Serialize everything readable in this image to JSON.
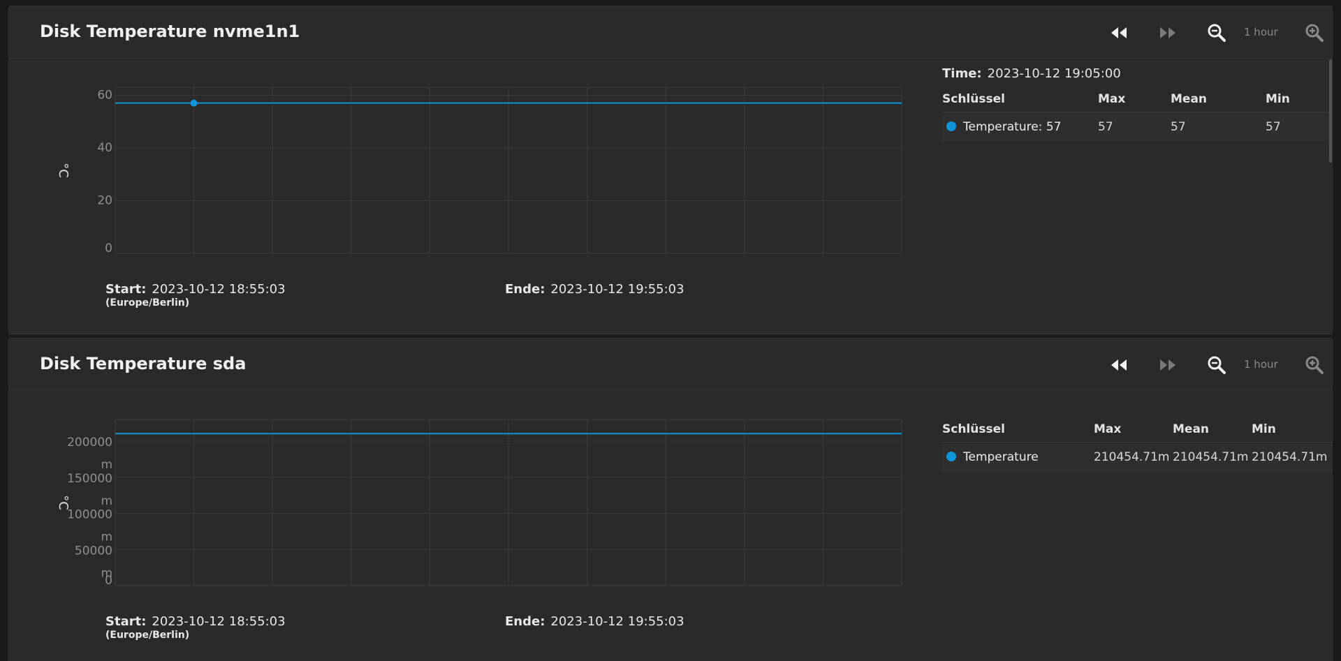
{
  "panels": [
    {
      "title": "Disk Temperature nvme1n1",
      "controls": {
        "range_label": "1 hour"
      },
      "legend": {
        "time_label": "Time:",
        "time_value": "2023-10-12 19:05:00",
        "headers": [
          "Schlüssel",
          "Max",
          "Mean",
          "Min"
        ],
        "rows": [
          {
            "key": "Temperature: 57",
            "max": "57",
            "mean": "57",
            "min": "57"
          }
        ]
      },
      "range": {
        "start_label": "Start:",
        "start_value": "2023-10-12 18:55:03",
        "timezone": "(Europe/Berlin)",
        "end_label": "Ende:",
        "end_value": "2023-10-12 19:55:03"
      },
      "chart_data": {
        "type": "line",
        "ylabel": "°C",
        "ylim": [
          0,
          63
        ],
        "yticks": [
          0,
          20,
          40,
          60
        ],
        "ytick_labels": [
          "0",
          "20",
          "40",
          "60"
        ],
        "xlim": [
          "19:00",
          "19:50"
        ],
        "xticks": [
          "19:00",
          "19:05",
          "19:10",
          "19:15",
          "19:20",
          "19:25",
          "19:30",
          "19:35",
          "19:40",
          "19:45"
        ],
        "grid": true,
        "series": [
          {
            "name": "Temperature",
            "color": "#0f95d9",
            "x": [
              "19:00",
              "19:50"
            ],
            "y": [
              57,
              57
            ],
            "highlight": {
              "x": "19:05",
              "y": 57
            }
          }
        ]
      }
    },
    {
      "title": "Disk Temperature sda",
      "controls": {
        "range_label": "1 hour"
      },
      "legend": {
        "headers": [
          "Schlüssel",
          "Max",
          "Mean",
          "Min"
        ],
        "rows": [
          {
            "key": "Temperature",
            "max": "210454.71m",
            "mean": "210454.71m",
            "min": "210454.71m"
          }
        ]
      },
      "range": {
        "start_label": "Start:",
        "start_value": "2023-10-12 18:55:03",
        "timezone": "(Europe/Berlin)",
        "end_label": "Ende:",
        "end_value": "2023-10-12 19:55:03"
      },
      "chart_data": {
        "type": "line",
        "ylabel": "°C",
        "ylim": [
          0,
          230000
        ],
        "yticks": [
          0,
          50000,
          100000,
          150000,
          200000
        ],
        "ytick_labels": [
          "0",
          "50000 m",
          "100000 m",
          "150000 m",
          "200000 m"
        ],
        "xlim": [
          "19:00",
          "19:50"
        ],
        "xticks": [
          "19:00",
          "19:05",
          "19:10",
          "19:15",
          "19:20",
          "19:25",
          "19:30",
          "19:35",
          "19:40",
          "19:45"
        ],
        "grid": true,
        "series": [
          {
            "name": "Temperature",
            "color": "#0f95d9",
            "x": [
              "19:00",
              "19:50"
            ],
            "y": [
              210454.71,
              210454.71
            ]
          }
        ]
      }
    }
  ]
}
